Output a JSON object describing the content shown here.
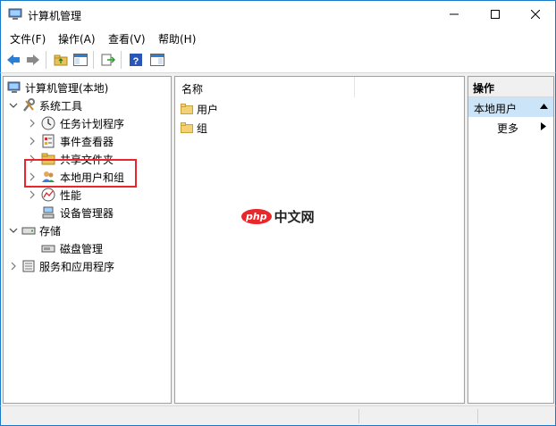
{
  "window": {
    "title": "计算机管理",
    "accent": "#1979ca"
  },
  "menu": [
    {
      "label": "文件(F)"
    },
    {
      "label": "操作(A)"
    },
    {
      "label": "查看(V)"
    },
    {
      "label": "帮助(H)"
    }
  ],
  "toolbar": {
    "icons": [
      "back-icon",
      "forward-icon",
      "up-folder-icon",
      "show-hide-tree-icon",
      "export-list-icon",
      "help-icon",
      "properties-icon"
    ]
  },
  "tree": {
    "root": "计算机管理(本地)",
    "system_tools": "系统工具",
    "task_scheduler": "任务计划程序",
    "event_viewer": "事件查看器",
    "shared_folders": "共享文件夹",
    "local_users": "本地用户和组",
    "performance": "性能",
    "device_manager": "设备管理器",
    "storage": "存储",
    "disk_management": "磁盘管理",
    "services_apps": "服务和应用程序"
  },
  "list": {
    "column_name": "名称",
    "items": [
      "用户",
      "组"
    ]
  },
  "actions": {
    "header": "操作",
    "section": "本地用户",
    "more": "更多"
  },
  "watermark": {
    "brand": "php",
    "text": "中文网"
  },
  "highlight_color": "#e8262b"
}
